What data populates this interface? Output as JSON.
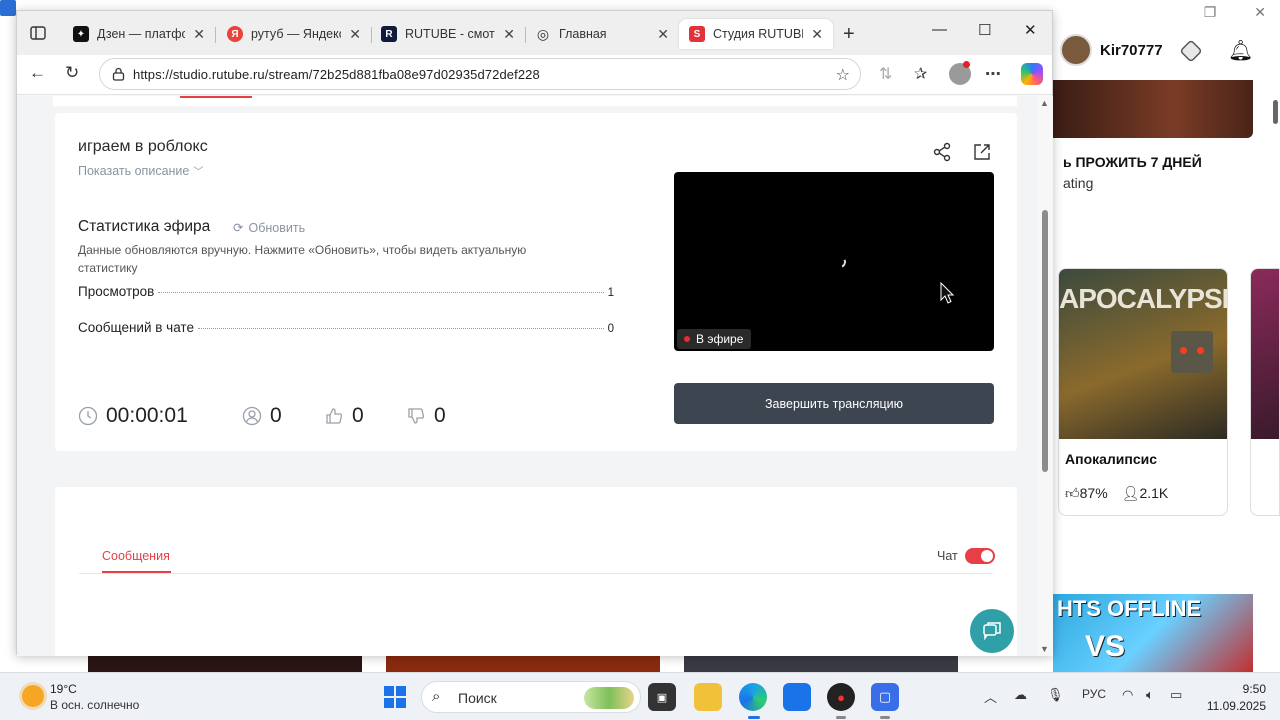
{
  "background_app": {
    "username": "Kir70777",
    "banner_title": "ь ПРОЖИТЬ 7 ДНЕЙ",
    "banner_sub": "ating",
    "card": {
      "image_text": "APOCALYPSE",
      "name": "Апокалипсис",
      "rating": "87%",
      "players": "2.1K"
    },
    "offline_banner": "HTS OFFLINE",
    "offline_vs": "VS"
  },
  "browser": {
    "tabs": [
      {
        "title": "Дзен — платфор",
        "favicon_color": "#111111",
        "favicon_char": "✦"
      },
      {
        "title": "рутуб — Яндекс",
        "favicon_color": "#e9443b",
        "favicon_char": "Я"
      },
      {
        "title": "RUTUBE - смотри",
        "favicon_color": "#101a3a",
        "favicon_char": "R"
      },
      {
        "title": "Главная",
        "favicon_color": "#ffffff",
        "favicon_char": "◎"
      },
      {
        "title": "Студия RUTUBE",
        "favicon_color": "#e0333a",
        "favicon_char": "S",
        "active": true
      }
    ],
    "url": "https://studio.rutube.ru/stream/72b25d881fba08e97d02935d72def228"
  },
  "stream": {
    "title": "играем в роблокс",
    "show_description": "Показать описание",
    "stats_title": "Статистика эфира",
    "refresh_label": "Обновить",
    "stats_note": "Данные обновляются вручную. Нажмите «Обновить», чтобы видеть актуальную статистику",
    "stats": [
      {
        "label": "Просмотров",
        "value": "1"
      },
      {
        "label": "Сообщений в чате",
        "value": "0"
      }
    ],
    "duration": "00:00:01",
    "viewers": "0",
    "likes": "0",
    "dislikes": "0",
    "live_badge": "В эфире",
    "end_button": "Завершить трансляцию",
    "messages_tab": "Сообщения",
    "chat_label": "Чат",
    "chat_enabled": true
  },
  "taskbar": {
    "temperature": "19°C",
    "weather": "В осн. солнечно",
    "search_label": "Поиск",
    "language": "РУС",
    "time": "9:50",
    "date": "11.09.2025"
  },
  "colors": {
    "accent_red": "#e64046",
    "end_button": "#3d4550",
    "fab": "#2f9fa8"
  }
}
